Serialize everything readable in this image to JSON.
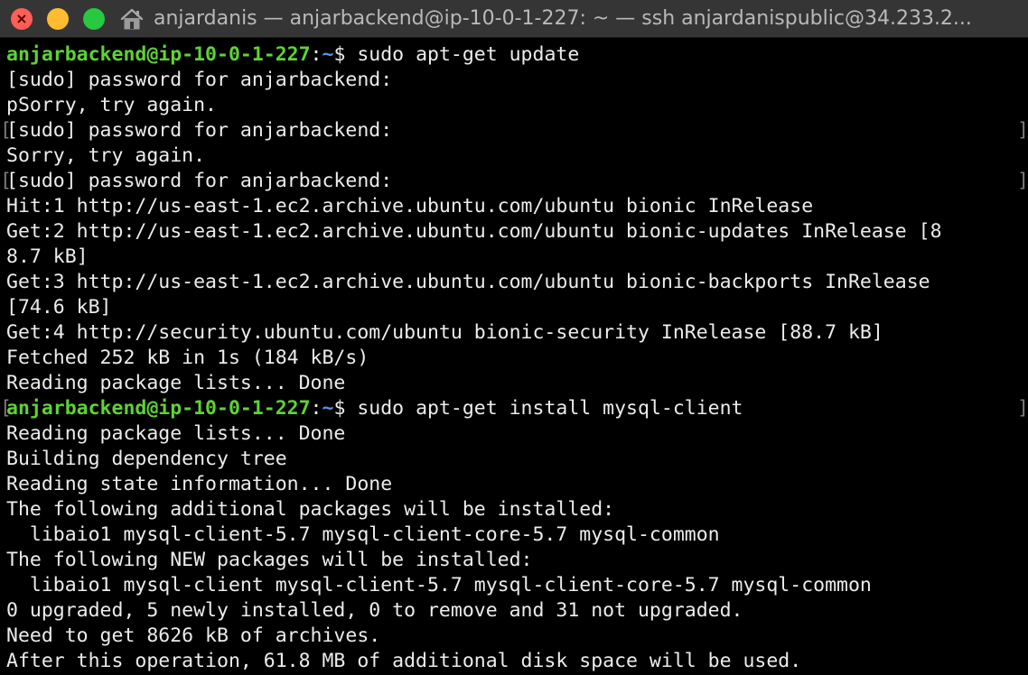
{
  "window": {
    "title": "anjardanis — anjarbackend@ip-10-0-1-227: ~ — ssh anjardanispublic@34.233.2...",
    "close_glyph": "×",
    "home_icon": "house-icon",
    "colors": {
      "close": "#ff5f57",
      "minimize": "#febc2e",
      "maximize": "#28c840",
      "prompt_user": "#5fd235",
      "prompt_path": "#5c8fe8",
      "text": "#ececec",
      "background": "#000000"
    }
  },
  "terminal": {
    "prompt_user_host": "anjarbackend@ip-10-0-1-227",
    "prompt_colon": ":",
    "prompt_path": "~",
    "prompt_symbol": "$ ",
    "bracket_left": "[",
    "bracket_right": "]",
    "lines": [
      {
        "prompt": true,
        "text": "sudo apt-get update"
      },
      {
        "text": "[sudo] password for anjarbackend:"
      },
      {
        "text": "pSorry, try again."
      },
      {
        "text": "[sudo] password for anjarbackend:",
        "brackets": true
      },
      {
        "text": "Sorry, try again."
      },
      {
        "text": "[sudo] password for anjarbackend:",
        "brackets": true
      },
      {
        "text": "Hit:1 http://us-east-1.ec2.archive.ubuntu.com/ubuntu bionic InRelease"
      },
      {
        "text": "Get:2 http://us-east-1.ec2.archive.ubuntu.com/ubuntu bionic-updates InRelease [8"
      },
      {
        "text": "8.7 kB]"
      },
      {
        "text": "Get:3 http://us-east-1.ec2.archive.ubuntu.com/ubuntu bionic-backports InRelease"
      },
      {
        "text": "[74.6 kB]"
      },
      {
        "text": "Get:4 http://security.ubuntu.com/ubuntu bionic-security InRelease [88.7 kB]"
      },
      {
        "text": "Fetched 252 kB in 1s (184 kB/s)"
      },
      {
        "text": "Reading package lists... Done"
      },
      {
        "prompt": true,
        "text": "sudo apt-get install mysql-client",
        "brackets": true
      },
      {
        "text": "Reading package lists... Done"
      },
      {
        "text": "Building dependency tree"
      },
      {
        "text": "Reading state information... Done"
      },
      {
        "text": "The following additional packages will be installed:"
      },
      {
        "text": "  libaio1 mysql-client-5.7 mysql-client-core-5.7 mysql-common"
      },
      {
        "text": "The following NEW packages will be installed:"
      },
      {
        "text": "  libaio1 mysql-client mysql-client-5.7 mysql-client-core-5.7 mysql-common"
      },
      {
        "text": "0 upgraded, 5 newly installed, 0 to remove and 31 not upgraded."
      },
      {
        "text": "Need to get 8626 kB of archives."
      },
      {
        "text": "After this operation, 61.8 MB of additional disk space will be used."
      }
    ]
  }
}
